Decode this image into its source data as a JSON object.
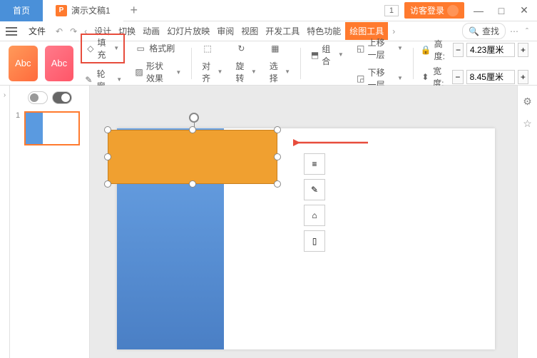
{
  "title": {
    "home": "首页",
    "doc": "演示文稿1",
    "docIcon": "P",
    "newTab": "+"
  },
  "winRight": {
    "num": "1",
    "login": "访客登录",
    "min": "—",
    "max": "□",
    "close": "✕"
  },
  "menu": {
    "file": "文件",
    "tabs": [
      "设计",
      "切换",
      "动画",
      "幻灯片放映",
      "审阅",
      "视图",
      "开发工具",
      "特色功能"
    ],
    "active": "绘图工具",
    "find": "查找",
    "findIcon": "🔍"
  },
  "ribbon": {
    "styleLabel": "Abc",
    "fill": "填充",
    "formatBrush": "格式刷",
    "outline": "轮廓",
    "shapeEffect": "形状效果",
    "align": "对齐",
    "rotate": "旋转",
    "select": "选择",
    "group": "组合",
    "upLayer": "上移一层",
    "downLayer": "下移一层",
    "height": "高度:",
    "heightVal": "4.23厘米",
    "width": "宽度:",
    "widthVal": "8.45厘米"
  },
  "thumb": {
    "num": "1"
  },
  "icons": {
    "bucket": "◇",
    "brush": "▭",
    "pen": "✎",
    "circle": "◯",
    "fx": "▨",
    "alignI": "⬚",
    "rotI": "↻",
    "selI": "▦",
    "grpI": "⬒",
    "upI": "◱",
    "dnI": "◲",
    "lockI": "🔒",
    "dimI": "⬍",
    "layers": "≡",
    "pencil": "✎",
    "home": "⌂",
    "page": "▯",
    "settings": "⚙",
    "star": "☆"
  }
}
